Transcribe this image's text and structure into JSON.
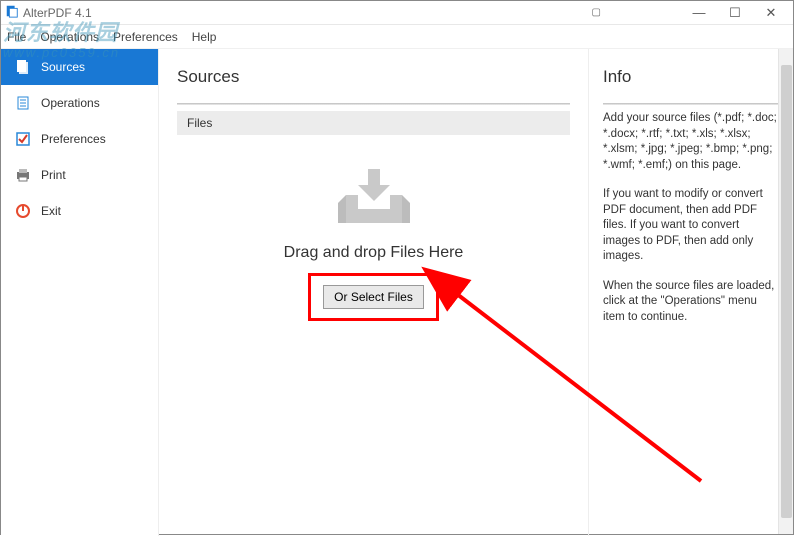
{
  "titlebar": {
    "app_name": "AlterPDF 4.1"
  },
  "menu": {
    "file": "File",
    "operations": "Operations",
    "preferences": "Preferences",
    "help": "Help"
  },
  "sidebar": {
    "sources": "Sources",
    "operations": "Operations",
    "preferences": "Preferences",
    "print": "Print",
    "exit": "Exit"
  },
  "content": {
    "title": "Sources",
    "files_header": "Files",
    "drop_label": "Drag and drop Files Here",
    "select_btn": "Or Select Files"
  },
  "info": {
    "title": "Info",
    "p1": "Add your source files (*.pdf; *.doc; *.docx; *.rtf; *.txt; *.xls; *.xlsx; *.xlsm; *.jpg; *.jpeg; *.bmp; *.png; *.wmf; *.emf;) on this page.",
    "p2": "If you want to modify or convert PDF document, then add PDF files. If you want to convert images to PDF, then add only images.",
    "p3": "When the source files are loaded, click at the \"Operations\" menu item to continue."
  },
  "watermark": {
    "main": "河东软件园",
    "sub": "www.pc0359.cn"
  }
}
